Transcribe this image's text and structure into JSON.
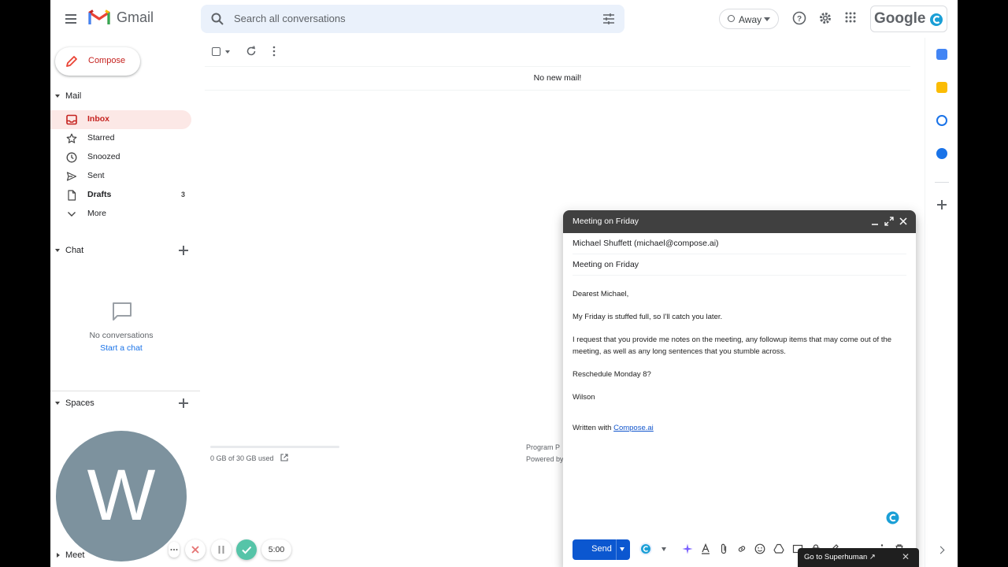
{
  "header": {
    "app_name": "Gmail",
    "search_placeholder": "Search all conversations",
    "status": "Away",
    "brand": "Google"
  },
  "sidebar": {
    "compose_label": "Compose",
    "mail_section": "Mail",
    "items": [
      {
        "label": "Inbox",
        "icon": "inbox-icon",
        "active": true,
        "count": ""
      },
      {
        "label": "Starred",
        "icon": "star-icon",
        "active": false,
        "count": ""
      },
      {
        "label": "Snoozed",
        "icon": "clock-icon",
        "active": false,
        "count": ""
      },
      {
        "label": "Sent",
        "icon": "send-icon",
        "active": false,
        "count": ""
      },
      {
        "label": "Drafts",
        "icon": "draft-icon",
        "active": false,
        "count": "3"
      },
      {
        "label": "More",
        "icon": "chevron-down-icon",
        "active": false,
        "count": ""
      }
    ],
    "chat_section": "Chat",
    "no_conversations": "No conversations",
    "start_chat": "Start a chat",
    "spaces_section": "Spaces",
    "meet_section": "Meet"
  },
  "main": {
    "empty_message": "No new mail!",
    "storage_text": "0 GB of 30 GB used",
    "storage_fraction": 0.0,
    "footer_line1": "Program P",
    "footer_line2": "Powered by"
  },
  "compose_window": {
    "title": "Meeting on Friday",
    "to": "Michael Shuffett (michael@compose.ai)",
    "subject": "Meeting on Friday",
    "body": {
      "greeting": "Dearest Michael,",
      "p1": "My Friday is stuffed full, so I'll catch you later.",
      "p2": "I request that you provide me notes on the meeting, any followup items that may come out of the meeting, as well as any long sentences that you stumble across.",
      "p3": "Reschedule Monday 8?",
      "signoff": "Wilson",
      "written_with": "Written with ",
      "link": "Compose.ai"
    },
    "send_label": "Send"
  },
  "recorder": {
    "avatar_letter": "W",
    "timer": "5:00"
  },
  "superhuman": {
    "label": "Go to Superhuman ↗"
  },
  "colors": {
    "accent_red": "#c5221f",
    "inbox_bg": "#fce8e6",
    "send_blue": "#0b57d0",
    "compose_header": "#404040",
    "search_bg": "#eaf1fb"
  }
}
